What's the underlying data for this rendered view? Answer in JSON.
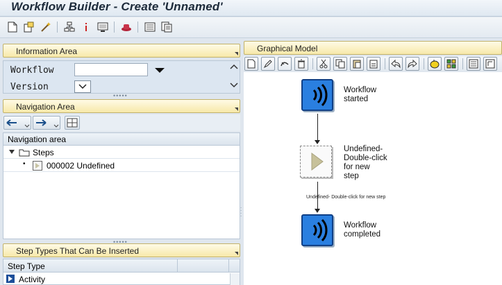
{
  "window": {
    "title": "Workflow Builder - Create 'Unnamed'"
  },
  "toolbar": {
    "icons": [
      "new-document-icon",
      "create-icon",
      "wand-icon",
      "hierarchy-icon",
      "info-icon",
      "display-icon",
      "hat-icon",
      "list-icon",
      "documents-icon"
    ]
  },
  "information_area": {
    "title": "Information Area",
    "workflow_label": "Workflow",
    "workflow_value": "",
    "version_label": "Version"
  },
  "navigation_area": {
    "title": "Navigation Area",
    "column_header": "Navigation area",
    "tree": [
      {
        "label": "Steps",
        "icon": "folder-icon",
        "expanded": true
      },
      {
        "label": "000002 Undefined",
        "icon": "step-icon"
      }
    ]
  },
  "step_types": {
    "title": "Step Types That Can Be Inserted",
    "column_header": "Step Type",
    "rows": [
      "Activity"
    ]
  },
  "graphical_model": {
    "title": "Graphical Model",
    "nodes": [
      {
        "label_line1": "Workflow",
        "label_line2": "started",
        "type": "event"
      },
      {
        "label_line1": "Undefined-",
        "label_line2": "Double-click",
        "label_line3": "for new",
        "label_line4": "step",
        "type": "undefined"
      },
      {
        "label_line1": "Workflow",
        "label_line2": "completed",
        "type": "event"
      }
    ],
    "connector_label": "Undefined- Double-click for new step"
  },
  "colors": {
    "panel_header": "#f7e9a9",
    "event_node": "#2a7fe0",
    "background": "#dfe6ee"
  }
}
